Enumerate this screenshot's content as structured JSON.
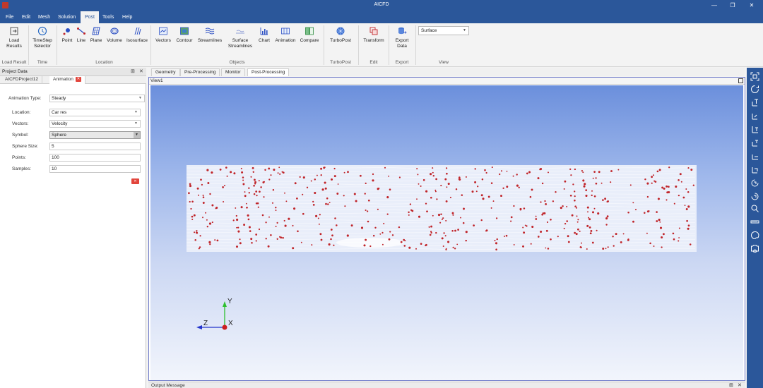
{
  "window": {
    "title": "AICFD",
    "minimize": "—",
    "restore": "❐",
    "close": "✕"
  },
  "menu": [
    "File",
    "Edit",
    "Mesh",
    "Solution",
    "Post",
    "Tools",
    "Help"
  ],
  "menu_active": "Post",
  "ribbon": {
    "load_results": [
      "Load",
      "Results"
    ],
    "timestep_selector": [
      "TimeStep",
      "Selector"
    ],
    "point": "Point",
    "line": "Line",
    "plane": "Plane",
    "volume": "Volume",
    "isosurface": "Isosurface",
    "vectors": "Vectors",
    "contour": "Contour",
    "streamlines": "Streamlines",
    "surface_streamlines": [
      "Surface",
      "Streamlines"
    ],
    "chart": "Chart",
    "animation": "Animation",
    "compare": "Compare",
    "turbopost": "TurboPost",
    "transform": "Transform",
    "export_data": [
      "Export",
      "Data"
    ],
    "view_select": "Surface",
    "groups": {
      "load_result": "Load Result",
      "time": "Time",
      "location": "Location",
      "objects": "Objects",
      "turbopost": "TurboPost",
      "edit": "Edit",
      "export": "Export",
      "view": "View"
    }
  },
  "left_panel": {
    "header": "Project Data",
    "pin": "⊞",
    "close": "✕",
    "tabs": {
      "project": "AICFDProject12",
      "animation": "Animation"
    },
    "tab_close": "✕",
    "fields": {
      "animation_type": {
        "label": "Animation Type:",
        "value": "Steady"
      },
      "location": {
        "label": "Location:",
        "value": "Car res"
      },
      "vectors": {
        "label": "Vectors:",
        "value": "Velocity"
      },
      "symbol": {
        "label": "Symbol:",
        "value": "Sphere"
      },
      "sphere_size": {
        "label": "Sphere Size:",
        "value": "5"
      },
      "points": {
        "label": "Points:",
        "value": "100"
      },
      "samples": {
        "label": "Samples:",
        "value": "10"
      }
    },
    "remove_button": "✕"
  },
  "doc_tabs": [
    "Geometry",
    "Pre-Processing",
    "Monitor",
    "Post-Processing"
  ],
  "doc_tab_active": "Post-Processing",
  "view": {
    "label": "View1",
    "axes": {
      "x": "X",
      "y": "Y",
      "z": "Z"
    },
    "colors": {
      "sphere": "#c0252a",
      "streamline": "#f4f6fc",
      "axis_y": "#2ec02e",
      "axis_z": "#2233cc",
      "axis_x": "#cc1f1f"
    }
  },
  "right_toolbar_icons": [
    "fit-view-icon",
    "rotate-icon",
    "view-xy-icon",
    "view-yx-icon",
    "view-xz-icon",
    "view-zx-icon",
    "view-yz-icon",
    "view-zy-icon",
    "rotate-90-icon",
    "rotate-neg-90-icon",
    "zoom-icon",
    "ruler-icon",
    "palette-icon",
    "screenshot-icon"
  ],
  "output": {
    "label": "Output Message",
    "pin": "⊞",
    "close": "✕"
  },
  "accent": "#2b579a"
}
